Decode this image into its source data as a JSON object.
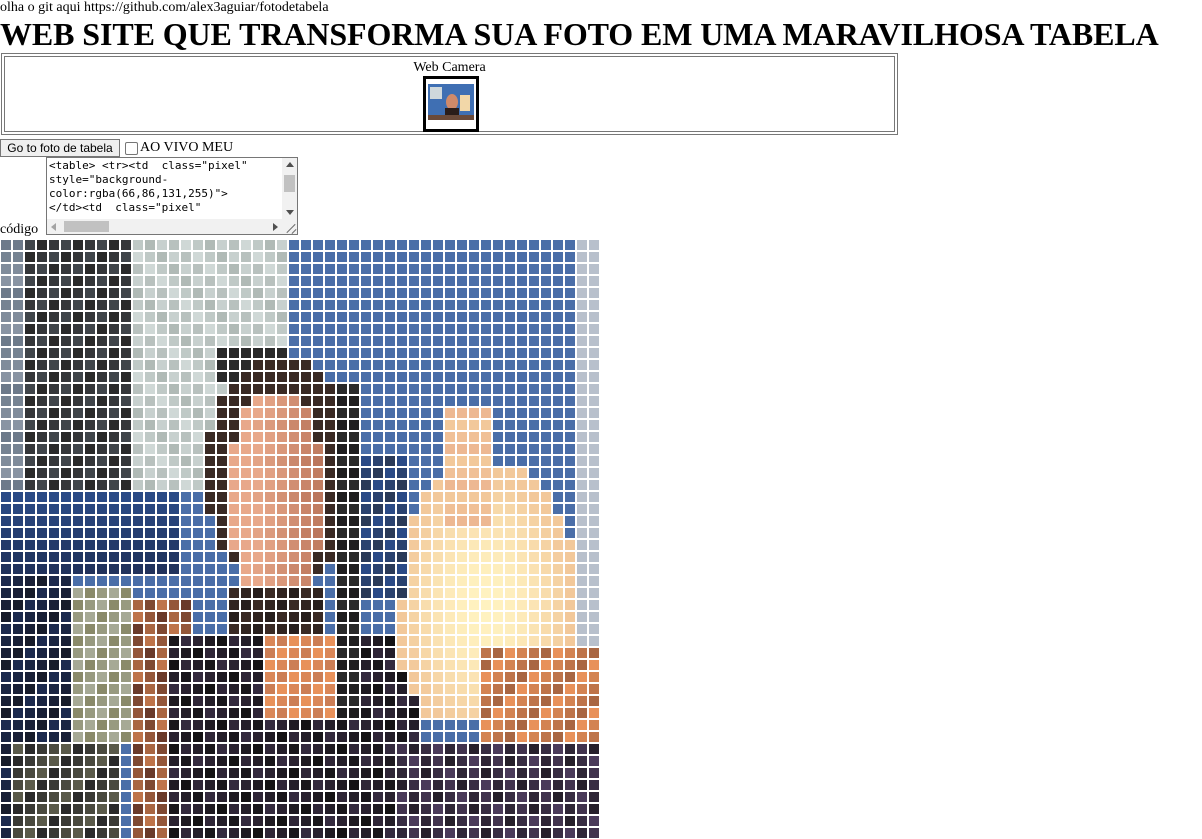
{
  "page": {
    "git_text": "olha o git aqui https://github.com/alex3aguiar/fotodetabela",
    "title": "WEB SITE QUE TRANSFORMA SUA FOTO EM UMA MARAVILHOSA TABELA"
  },
  "webcam": {
    "label": "Web Camera"
  },
  "controls": {
    "button_label": "Go to foto de tabela",
    "checkbox_label": "AO VIVO MEU",
    "checkbox_checked": false
  },
  "code": {
    "content": "<table> <tr><td  class=\"pixel\"\nstyle=\"background-\ncolor:rgba(66,86,131,255)\">\n</td><td  class=\"pixel\"",
    "label": "código"
  },
  "pixel_table": {
    "columns": 50,
    "rows_visible": 50,
    "description_palette": {
      "background_blue": "#4a6ea8",
      "dark_left": "#2a2a2a",
      "window_light": "#d0d8d6",
      "skin": "#e8a88a",
      "lamp_light": "#fff2c0",
      "orange_glow": "#e8915a",
      "dark_bottom": "#1a1418"
    }
  }
}
